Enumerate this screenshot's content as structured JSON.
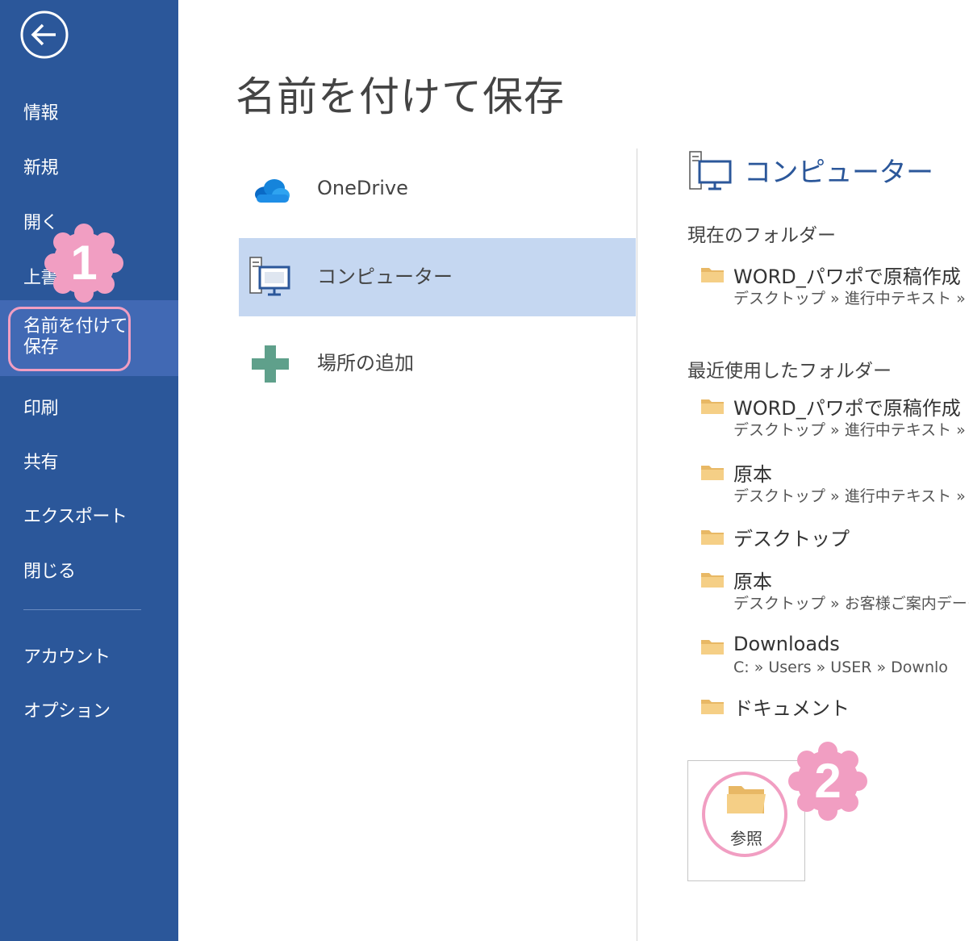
{
  "colors": {
    "sidebar_bg": "#2b579a",
    "sidebar_active_bg": "#4169b4",
    "selection_bg": "#c5d7f1",
    "accent": "#2b579a",
    "annotation_pink": "#f19ec2",
    "folder_yellow": "#f0c77a"
  },
  "sidebar": {
    "back_icon": "back-arrow-icon",
    "items": [
      {
        "label": "情報"
      },
      {
        "label": "新規"
      },
      {
        "label": "開く"
      },
      {
        "label": "上書き保存"
      },
      {
        "label": "名前を付けて保存",
        "line1": "名前を付けて",
        "line2": "保存",
        "active": true
      },
      {
        "label": "印刷"
      },
      {
        "label": "共有"
      },
      {
        "label": "エクスポート"
      },
      {
        "label": "閉じる"
      },
      {
        "label": "アカウント"
      },
      {
        "label": "オプション"
      }
    ]
  },
  "annotations": {
    "badge1": "1",
    "badge2": "2"
  },
  "main": {
    "title": "名前を付けて保存",
    "locations": [
      {
        "label": "OneDrive",
        "icon": "cloud-icon"
      },
      {
        "label": "コンピューター",
        "icon": "computer-icon",
        "selected": true
      },
      {
        "label": "場所の追加",
        "icon": "plus-icon"
      }
    ]
  },
  "right": {
    "heading": "コンピューター",
    "heading_icon": "computer-icon",
    "current_label": "現在のフォルダー",
    "current": [
      {
        "name": "WORD_パワポで原稿作成",
        "path": "デスクトップ » 進行中テキスト » 卒"
      }
    ],
    "recent_label": "最近使用したフォルダー",
    "recent": [
      {
        "name": "WORD_パワポで原稿作成",
        "path": "デスクトップ » 進行中テキスト » 卒"
      },
      {
        "name": "原本",
        "path": "デスクトップ » 進行中テキスト » 卒"
      },
      {
        "name": "デスクトップ",
        "path": ""
      },
      {
        "name": "原本",
        "path": "デスクトップ » お客様ご案内データb"
      },
      {
        "name": "Downloads",
        "path": "C: » Users » USER » Downlo"
      },
      {
        "name": "ドキュメント",
        "path": ""
      }
    ],
    "browse_label": "参照",
    "browse_icon": "open-folder-icon"
  }
}
